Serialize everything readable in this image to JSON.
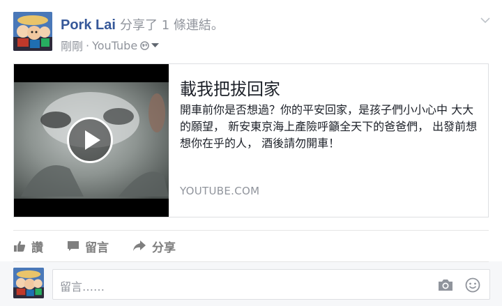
{
  "post": {
    "author": "Pork Lai",
    "action_text": "分享了 1 條連結。",
    "time": "剛剛",
    "separator": "·",
    "source": "YouTube"
  },
  "link": {
    "title": "載我把拔回家",
    "description": "開車前你是否想過？你的平安回家，是孩子們小小心中 大大的願望， 新安東京海上產險呼籲全天下的爸爸們， 出發前想想你在乎的人， 酒後請勿開車！",
    "domain": "YOUTUBE.COM"
  },
  "actions": {
    "like": "讚",
    "comment": "留言",
    "share": "分享"
  },
  "comment_box": {
    "placeholder": "留言……"
  },
  "colors": {
    "author_link": "#365899",
    "muted": "#90949c",
    "action": "#7f7f7f"
  }
}
